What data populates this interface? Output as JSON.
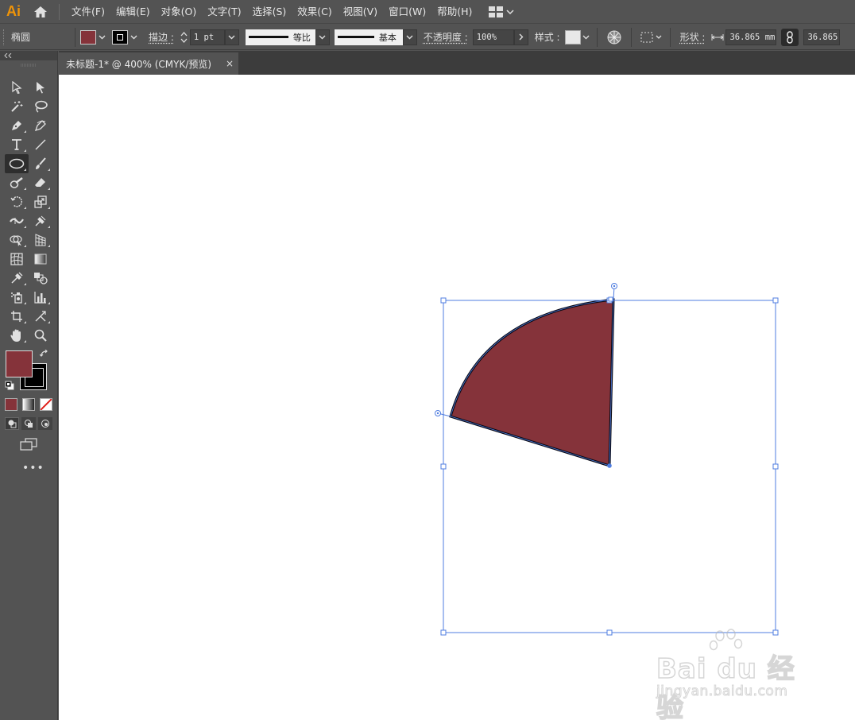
{
  "app": {
    "logo": "Ai"
  },
  "menu": {
    "items": [
      "文件(F)",
      "编辑(E)",
      "对象(O)",
      "文字(T)",
      "选择(S)",
      "效果(C)",
      "视图(V)",
      "窗口(W)",
      "帮助(H)"
    ]
  },
  "control_bar": {
    "object_type": "椭圆",
    "stroke_label": "描边 :",
    "stroke_weight": "1 pt",
    "profile_label": "等比",
    "brush_label": "基本",
    "opacity_label": "不透明度 :",
    "opacity_value": "100%",
    "style_label": "样式 :",
    "shape_label": "形状 :",
    "width_value": "36.865 mm",
    "height_value": "36.865",
    "fill_color": "#85333a"
  },
  "tab": {
    "title": "未标题-1* @ 400% (CMYK/预览)",
    "close": "×"
  },
  "toolbar": {
    "tools": [
      "direct-selection-tool",
      "selection-tool",
      "magic-wand-tool",
      "lasso-tool",
      "pen-tool",
      "curvature-tool",
      "type-tool",
      "line-tool",
      "ellipse-tool",
      "paintbrush-tool",
      "shaper-tool",
      "eraser-tool",
      "rotate-tool",
      "scale-tool",
      "width-tool",
      "puppet-warp-tool",
      "shape-builder-tool",
      "perspective-grid-tool",
      "mesh-tool",
      "gradient-tool",
      "eyedropper-tool",
      "blend-tool",
      "symbol-sprayer-tool",
      "column-graph-tool",
      "artboard-tool",
      "slice-tool",
      "hand-tool",
      "zoom-tool"
    ],
    "active_tool": "ellipse-tool",
    "more": "•••"
  },
  "watermark": {
    "brand": "Bai du 经验",
    "url": "jingyan.baidu.com"
  }
}
